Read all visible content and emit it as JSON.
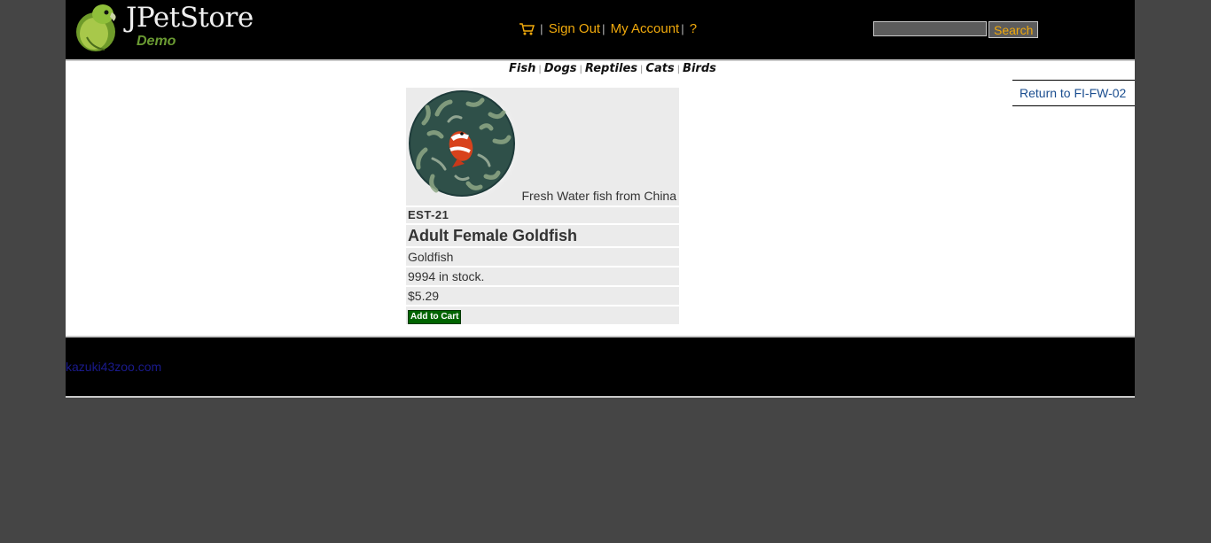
{
  "header": {
    "logo_title": "JPetStore",
    "logo_subtitle": "Demo",
    "menu": {
      "cart_icon": "shopping-cart-icon",
      "sign_out": "Sign Out",
      "my_account": "My Account",
      "help": "?"
    },
    "search": {
      "value": "",
      "button_label": "Search"
    }
  },
  "quicklinks": [
    "Fish",
    "Dogs",
    "Reptiles",
    "Cats",
    "Birds"
  ],
  "return_link": "Return to FI-FW-02",
  "item": {
    "image_icon": "clownfish-image",
    "description": "Fresh Water fish from China",
    "item_id": "EST-21",
    "name": "Adult Female Goldfish",
    "product": "Goldfish",
    "stock": "9994 in stock.",
    "price": "$5.29",
    "add_to_cart": "Add to Cart"
  },
  "footer": {
    "link": "kazuki43zoo.com"
  },
  "colors": {
    "background": "#454545",
    "header": "#000000",
    "menu_link": "#f0a90c",
    "add_to_cart": "#006400",
    "item_row": "#ebebeb"
  }
}
